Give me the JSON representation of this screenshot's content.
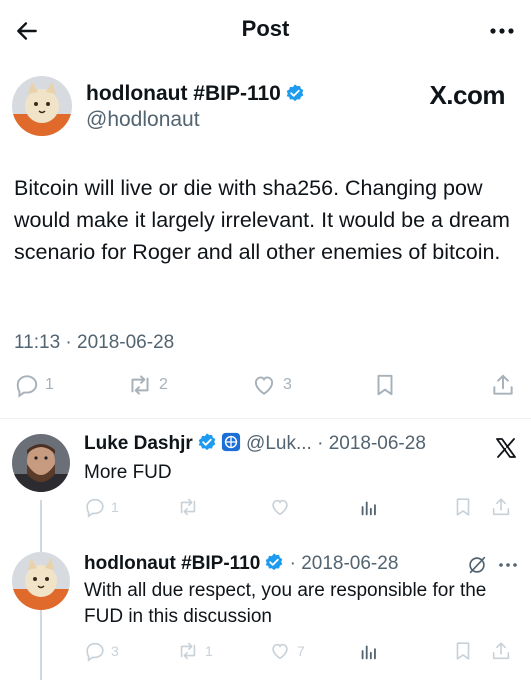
{
  "header": {
    "title": "Post"
  },
  "main_post": {
    "author_name": "hodlonaut #BIP-110",
    "handle": "@hodlonaut",
    "source_brand": "X.com",
    "text": "Bitcoin will live or die with sha256. Changing pow would make it largely irrelevant. It would be a dream scenario for Roger and all other enemies of bitcoin.",
    "timestamp": "11:13 · 2018-06-28",
    "stats": {
      "replies": "1",
      "reposts": "2",
      "likes": "3"
    }
  },
  "replies": [
    {
      "author_name": "Luke Dashjr",
      "handle": "@Luk...",
      "date": "· 2018-06-28",
      "text": "More FUD",
      "stats": {
        "replies": "1",
        "reposts": "",
        "likes": ""
      }
    },
    {
      "author_name": "hodlonaut #BIP-110",
      "handle": "",
      "date": "· 2018-06-28",
      "text": "With all due respect, you are responsible for the FUD in this discussion",
      "stats": {
        "replies": "3",
        "reposts": "1",
        "likes": "7"
      }
    }
  ],
  "colors": {
    "verified": "#1d9bf0",
    "muted": "#536471",
    "icon_gray": "#a7b1ba",
    "divider": "#eff3f4"
  },
  "icons": [
    "back-arrow-icon",
    "more-icon",
    "verified-badge-icon",
    "org-badge-icon",
    "reply-icon",
    "repost-icon",
    "like-icon",
    "views-icon",
    "bookmark-icon",
    "share-icon",
    "x-logo-icon",
    "grok-icon"
  ]
}
